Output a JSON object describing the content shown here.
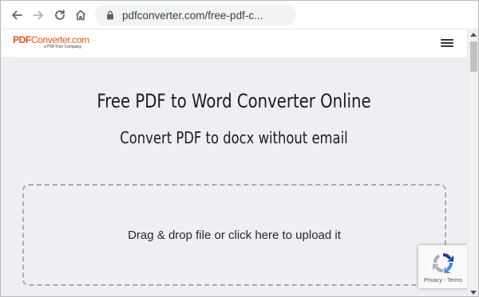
{
  "browser": {
    "url": "pdfconverter.com/free-pdf-c...",
    "icons": {
      "back": "arrow-left-icon",
      "forward": "arrow-right-icon",
      "reload": "reload-icon",
      "home": "home-icon",
      "lock": "lock-icon"
    }
  },
  "site": {
    "logo": {
      "brand_part1": "PDF",
      "brand_part2": "Converter.com",
      "tagline": "a PDFTron Company"
    },
    "menu_icon": "hamburger-icon"
  },
  "main": {
    "title": "Free PDF to Word Converter Online",
    "subtitle": "Convert PDF to docx without email",
    "dropzone_text": "Drag & drop file or click here to upload it"
  },
  "recaptcha": {
    "links": "Privacy - Terms"
  },
  "colors": {
    "brand": "#e8541f",
    "content_bg": "#efeef3",
    "toolbar_bg": "#ffffff",
    "address_bg": "#f1f3f4"
  }
}
